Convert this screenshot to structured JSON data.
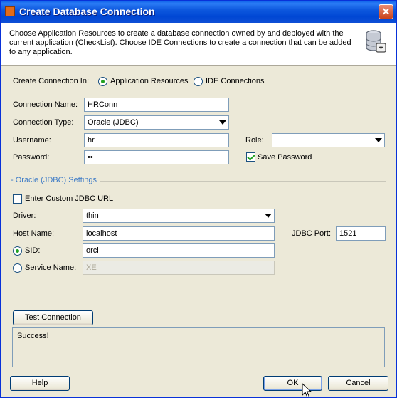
{
  "window": {
    "title": "Create Database Connection",
    "close_glyph": "✕"
  },
  "header": {
    "description": "Choose Application Resources to create a database connection owned by and deployed with the current application (CheckList). Choose IDE Connections to create a connection that can be added to any application.",
    "icon": "database-icon"
  },
  "create_in": {
    "label": "Create Connection In:",
    "options": [
      {
        "label": "Application Resources",
        "selected": true
      },
      {
        "label": "IDE Connections",
        "selected": false
      }
    ]
  },
  "form": {
    "connection_name_label": "Connection Name:",
    "connection_name_value": "HRConn",
    "connection_type_label": "Connection Type:",
    "connection_type_value": "Oracle (JDBC)",
    "username_label": "Username:",
    "username_value": "hr",
    "password_label": "Password:",
    "password_value": "••",
    "role_label": "Role:",
    "role_value": "",
    "save_password_label": "Save Password",
    "save_password_checked": true
  },
  "settings": {
    "section_title": "- Oracle (JDBC) Settings",
    "custom_url_label": "Enter Custom JDBC URL",
    "custom_url_checked": false,
    "driver_label": "Driver:",
    "driver_value": "thin",
    "host_label": "Host Name:",
    "host_value": "localhost",
    "port_label": "JDBC Port:",
    "port_value": "1521",
    "sid_label": "SID:",
    "sid_value": "orcl",
    "sid_selected": true,
    "service_label": "Service Name:",
    "service_value": "XE",
    "service_selected": false
  },
  "test": {
    "button_label": "Test Connection",
    "result": "Success!"
  },
  "footer": {
    "help_label": "Help",
    "ok_label": "OK",
    "cancel_label": "Cancel"
  },
  "colors": {
    "titlebar": "#0054e3",
    "dialog_bg": "#ece9d8",
    "section_title": "#3c7ac6",
    "radio_dot": "#21a121"
  }
}
